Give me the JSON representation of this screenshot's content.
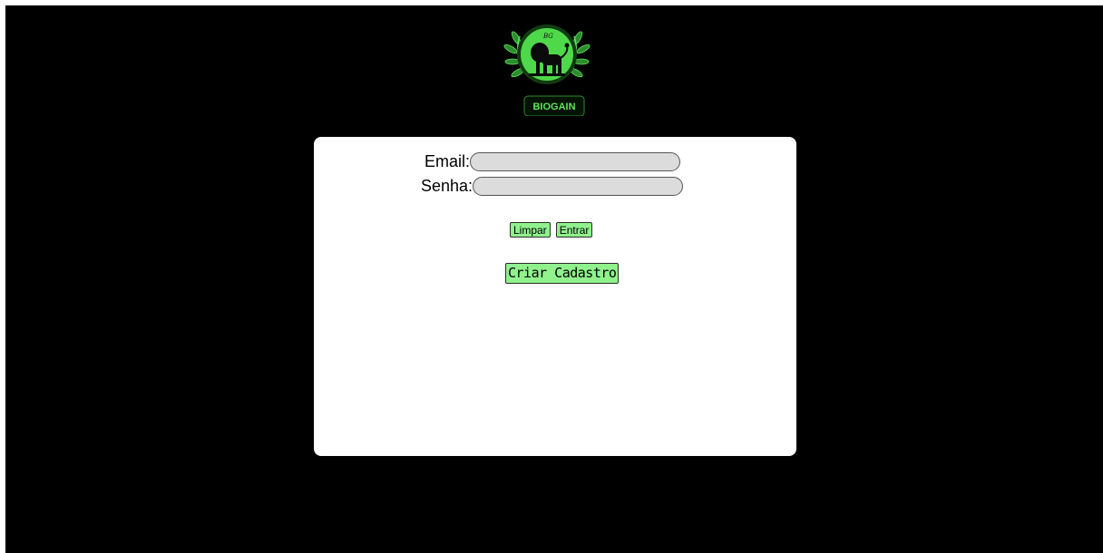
{
  "brand": {
    "name": "BIOGAIN",
    "monogram": "BG"
  },
  "login": {
    "email_label": "Email:",
    "email_value": "",
    "senha_label": "Senha:",
    "senha_value": "",
    "clear_label": "Limpar",
    "enter_label": "Entrar",
    "create_label": "Criar Cadastro"
  },
  "colors": {
    "background": "#000000",
    "card": "#ffffff",
    "button_green": "#8ff28c",
    "brand_green": "#4fd84a",
    "field": "#dcdcdc"
  }
}
